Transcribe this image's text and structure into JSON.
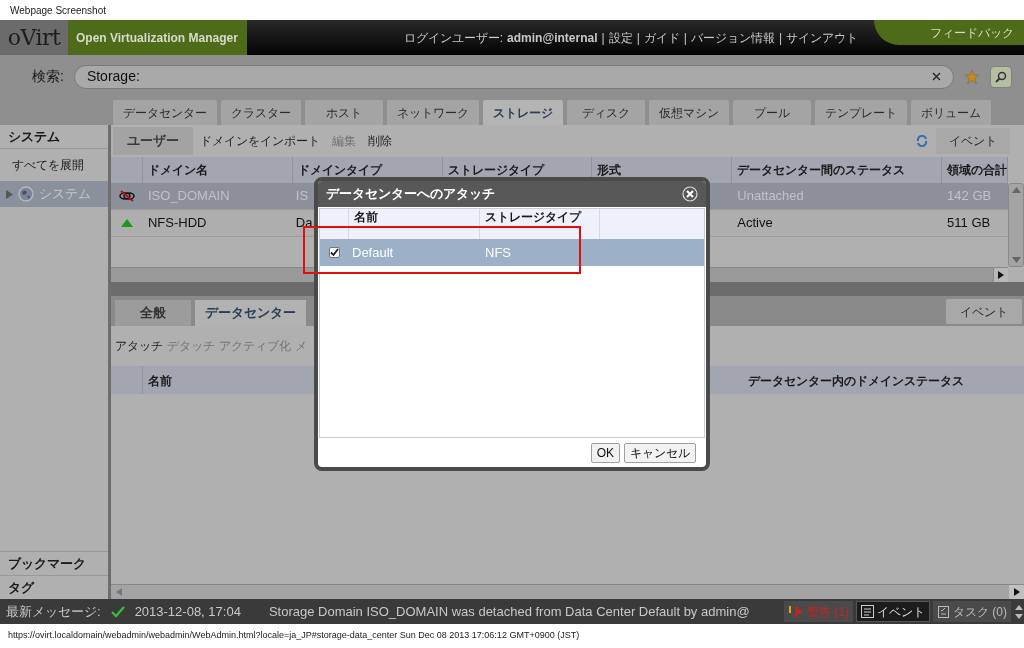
{
  "caption": "Webpage Screenshot",
  "header": {
    "logo": "oVirt",
    "product": "Open Virtualization Manager",
    "user_label": "ログインユーザー:",
    "user": "admin@internal",
    "separator": "|",
    "links": [
      "設定",
      "ガイド",
      "バージョン情報",
      "サインアウト"
    ],
    "feedback": "フィードバック"
  },
  "search": {
    "label": "検索:",
    "value": "Storage:"
  },
  "main_tabs": [
    {
      "label": "データセンター",
      "selected": false
    },
    {
      "label": "クラスター",
      "selected": false
    },
    {
      "label": "ホスト",
      "selected": false
    },
    {
      "label": "ネットワーク",
      "selected": false
    },
    {
      "label": "ストレージ",
      "selected": true
    },
    {
      "label": "ディスク",
      "selected": false
    },
    {
      "label": "仮想マシン",
      "selected": false
    },
    {
      "label": "プール",
      "selected": false
    },
    {
      "label": "テンプレート",
      "selected": false
    },
    {
      "label": "ボリューム",
      "selected": false
    }
  ],
  "sidebar": {
    "title": "システム",
    "expand_all": "すべてを展開",
    "tree": [
      {
        "label": "システム",
        "selected": true,
        "expanded": false
      }
    ],
    "bottom": [
      "ブックマーク",
      "タグ"
    ]
  },
  "top_pane": {
    "user_tab": "ユーザー",
    "actions": [
      {
        "label": "ドメインをインポート",
        "disabled": false
      },
      {
        "label": "編集",
        "disabled": true
      },
      {
        "label": "削除",
        "disabled": false
      }
    ],
    "events_button": "イベント",
    "columns": [
      "ドメイン名",
      "ドメインタイプ",
      "ストレージタイプ",
      "形式",
      "データセンター間のステータス",
      "領域の合計"
    ],
    "rows": [
      {
        "kind": "unattached",
        "selected": true,
        "name": "ISO_DOMAIN",
        "domain_type": "IS",
        "dc_status": "Unattached",
        "total": "142 GB"
      },
      {
        "kind": "up",
        "selected": false,
        "name": "NFS-HDD",
        "domain_type": "Da",
        "dc_status": "Active",
        "total": "511 GB"
      }
    ]
  },
  "lower_pane": {
    "tabs": [
      {
        "label": "全般",
        "selected": false
      },
      {
        "label": "データセンター",
        "selected": true
      }
    ],
    "actions": [
      {
        "label": "アタッチ",
        "disabled": false
      },
      {
        "label": "デタッチ",
        "disabled": true
      },
      {
        "label": "アクティブ化",
        "disabled": true
      },
      {
        "label": "メ",
        "disabled": true
      }
    ],
    "events_button": "イベント",
    "columns": [
      "名前",
      "データセンター内のドメインステータス"
    ]
  },
  "dialog": {
    "title": "データセンターへのアタッチ",
    "columns": [
      "名前",
      "ストレージタイプ"
    ],
    "rows": [
      {
        "checked": true,
        "selected": true,
        "name": "Default",
        "type": "NFS"
      }
    ],
    "buttons": [
      "OK",
      "キャンセル"
    ]
  },
  "status_bar": {
    "label": "最新メッセージ:",
    "time": "2013-12-08, 17:04",
    "message": "Storage Domain ISO_DOMAIN was detached from Data Center Default by admin@",
    "alerts": "警告 (1)",
    "events": "イベント",
    "tasks": "タスク (0)"
  },
  "footer": "https://ovirt.localdomain/webadmin/webadmin/WebAdmin.html?locale=ja_JP#storage-data_center Sun Dec 08 2013 17:06:12 GMT+0900 (JST)"
}
